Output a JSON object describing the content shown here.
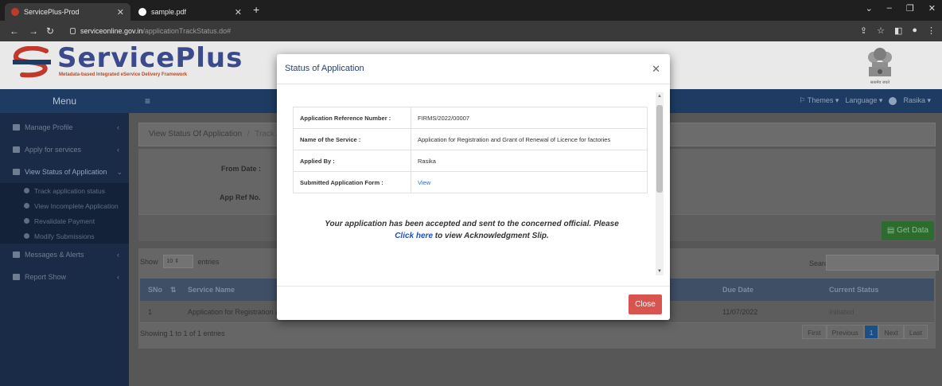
{
  "browser": {
    "tabs": [
      {
        "title": "ServicePlus-Prod",
        "active": true
      },
      {
        "title": "sample.pdf",
        "active": false
      }
    ],
    "address": {
      "domain": "serviceonline.gov.in",
      "path": "/applicationTrackStatus.do#"
    }
  },
  "header": {
    "logo_text": "ServicePlus",
    "tagline": "Metadata-based Integrated eService Delivery Framework",
    "emblem_label": "सत्यमेव जयते"
  },
  "sidebar": {
    "menu_label": "Menu",
    "items": [
      {
        "label": "Manage Profile",
        "icon": "users-icon"
      },
      {
        "label": "Apply for services",
        "icon": "cogs-icon"
      },
      {
        "label": "View Status of Application",
        "icon": "list-icon",
        "expanded": true
      },
      {
        "label": "Messages & Alerts",
        "icon": "message-icon"
      },
      {
        "label": "Report Show",
        "icon": "report-icon"
      }
    ],
    "subitems": [
      "Track application status",
      "View Incomplete Application",
      "Revalidate Payment",
      "Modify Submissions"
    ]
  },
  "topnav": {
    "themes": "Themes",
    "language": "Language",
    "user": "Rasika"
  },
  "page": {
    "breadcrumb_1": "View Status Of Application",
    "breadcrumb_sep": "/",
    "breadcrumb_2": "Track Ap",
    "from_date_label": "From Date :",
    "app_ref_label": "App Ref No.",
    "get_data_label": "Get Data",
    "show_label": "Show",
    "show_value": "10",
    "entries_label": "entries",
    "search_label": "Search",
    "columns": {
      "sno": "SNo",
      "service": "Service Name",
      "due": "Due Date",
      "status": "Current Status"
    },
    "row": {
      "sno": "1",
      "service": "Application for Registration a",
      "due": "11/07/2022",
      "status": "Initiated"
    },
    "showing": "Showing 1 to 1 of 1 entries",
    "pager": [
      "First",
      "Previous",
      "1",
      "Next",
      "Last"
    ]
  },
  "modal": {
    "title": "Status of Application",
    "rows": [
      {
        "key": "Application Reference Number :",
        "value": "FIRMS/2022/00007"
      },
      {
        "key": "Name of the Service :",
        "value": "Application for Registration and Grant of Renewal of Licence for factories"
      },
      {
        "key": "Applied By :",
        "value": "Rasika"
      },
      {
        "key": "Submitted Application Form :",
        "value": "View"
      }
    ],
    "message_1": "Your application has been accepted and sent to the concerned official. Please",
    "message_link": "Click here",
    "message_2": "to view Acknowledgment Slip.",
    "close_label": "Close"
  }
}
